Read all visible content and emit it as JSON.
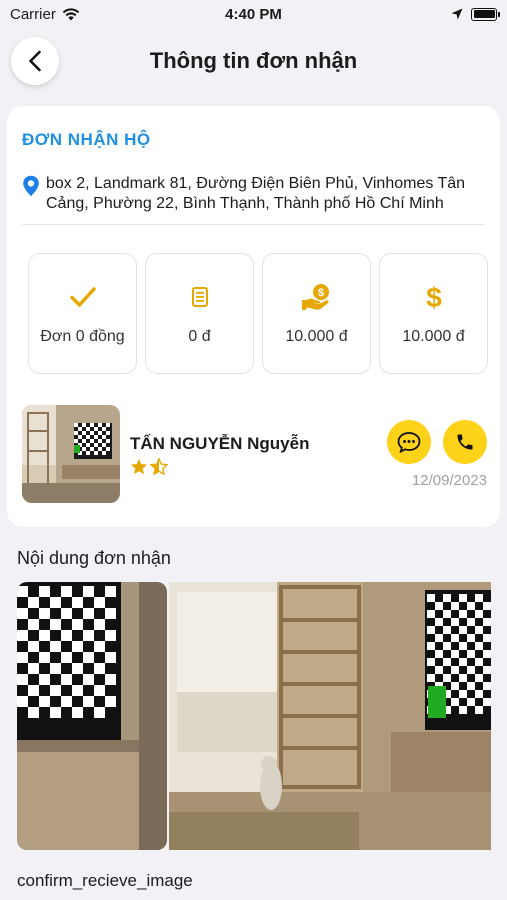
{
  "status_bar": {
    "carrier": "Carrier",
    "time": "4:40 PM"
  },
  "header": {
    "title": "Thông tin đơn nhận"
  },
  "order": {
    "type_label": "ĐƠN NHẬN HỘ",
    "address": "box 2, Landmark 81, Đường Điện Biên Phủ, Vinhomes Tân Cảng, Phường 22, Bình Thạnh, Thành phố Hồ Chí Minh",
    "stats": [
      {
        "icon": "check-icon",
        "value": "Đơn 0 đồng"
      },
      {
        "icon": "document-icon",
        "value": "0 đ"
      },
      {
        "icon": "hand-coin-icon",
        "value": "10.000 đ"
      },
      {
        "icon": "dollar-icon",
        "value": "10.000 đ"
      }
    ]
  },
  "sender": {
    "name": "TẤN NGUYỄN Nguyễn",
    "rating": 1.5,
    "date": "12/09/2023"
  },
  "content": {
    "section_title": "Nội dung đơn nhận",
    "image_caption": "confirm_recieve_image"
  },
  "colors": {
    "accent_yellow": "#ffd21a",
    "icon_gold": "#e6a800",
    "link_blue": "#1e90e6",
    "background": "#f2f2f6"
  }
}
